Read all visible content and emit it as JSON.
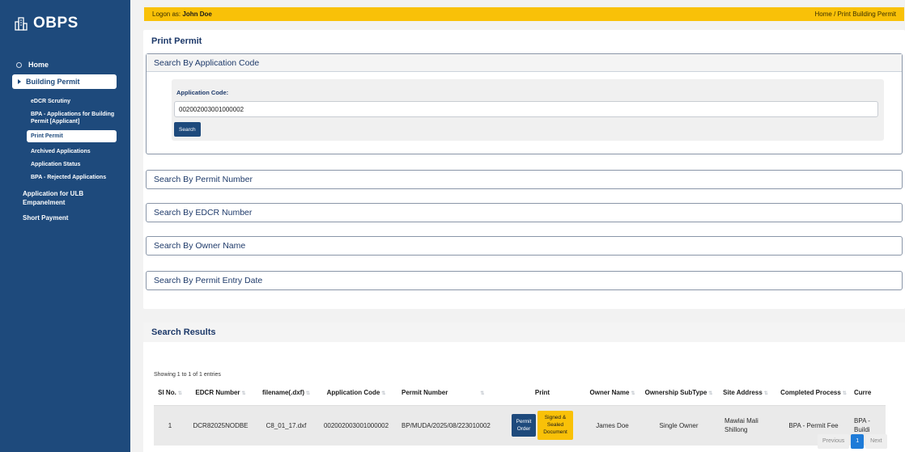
{
  "sidebar": {
    "brand": "OBPS",
    "home": "Home",
    "active": "Building Permit",
    "sub_items": [
      "eDCR Scrutiny",
      "BPA - Applications for Building Permit [Applicant]"
    ],
    "sub_active": "Print Permit",
    "sub_items_after": [
      "Archived Applications",
      "Application Status",
      "BPA - Rejected Applications"
    ],
    "main_items": [
      "Application for ULB Empanelment",
      "Short Payment"
    ]
  },
  "topbar": {
    "logon_prefix": "Logon as:",
    "user": "John Doe",
    "breadcrumb": "Home / Print Building Permit"
  },
  "main": {
    "title": "Print Permit",
    "sections": [
      "Search By Application Code",
      "Search By Permit Number",
      "Search By EDCR Number",
      "Search By Owner Name",
      "Search By Permit Entry Date"
    ],
    "field_label": "Application Code:",
    "field_value": "002002003001000002",
    "search_label": "Search"
  },
  "results": {
    "title": "Search Results",
    "showing": "Showing 1 to 1 of 1 entries",
    "columns": [
      "Sl No.",
      "EDCR Number",
      "filename(.dxf)",
      "Application Code",
      "Permit Number",
      "Print",
      "Owner Name",
      "Ownership SubType",
      "Site Address",
      "Completed Process",
      "Curre"
    ],
    "row": {
      "sl": "1",
      "edcr": "DCR82025NODBE",
      "filename": "C8_01_17.dxf",
      "app_code": "002002003001000002",
      "permit": "BP/MUDA/2025/08/223010002",
      "print_primary": "Permit Order",
      "print_secondary": "Signed & Sealed Document",
      "owner": "James Doe",
      "subtype": "Single Owner",
      "address": "Mawlai Mali Shillong",
      "process": "BPA - Permit Fee",
      "current": "BPA - Buildi"
    },
    "pager": {
      "previous": "Previous",
      "page": "1",
      "next": "Next"
    }
  }
}
